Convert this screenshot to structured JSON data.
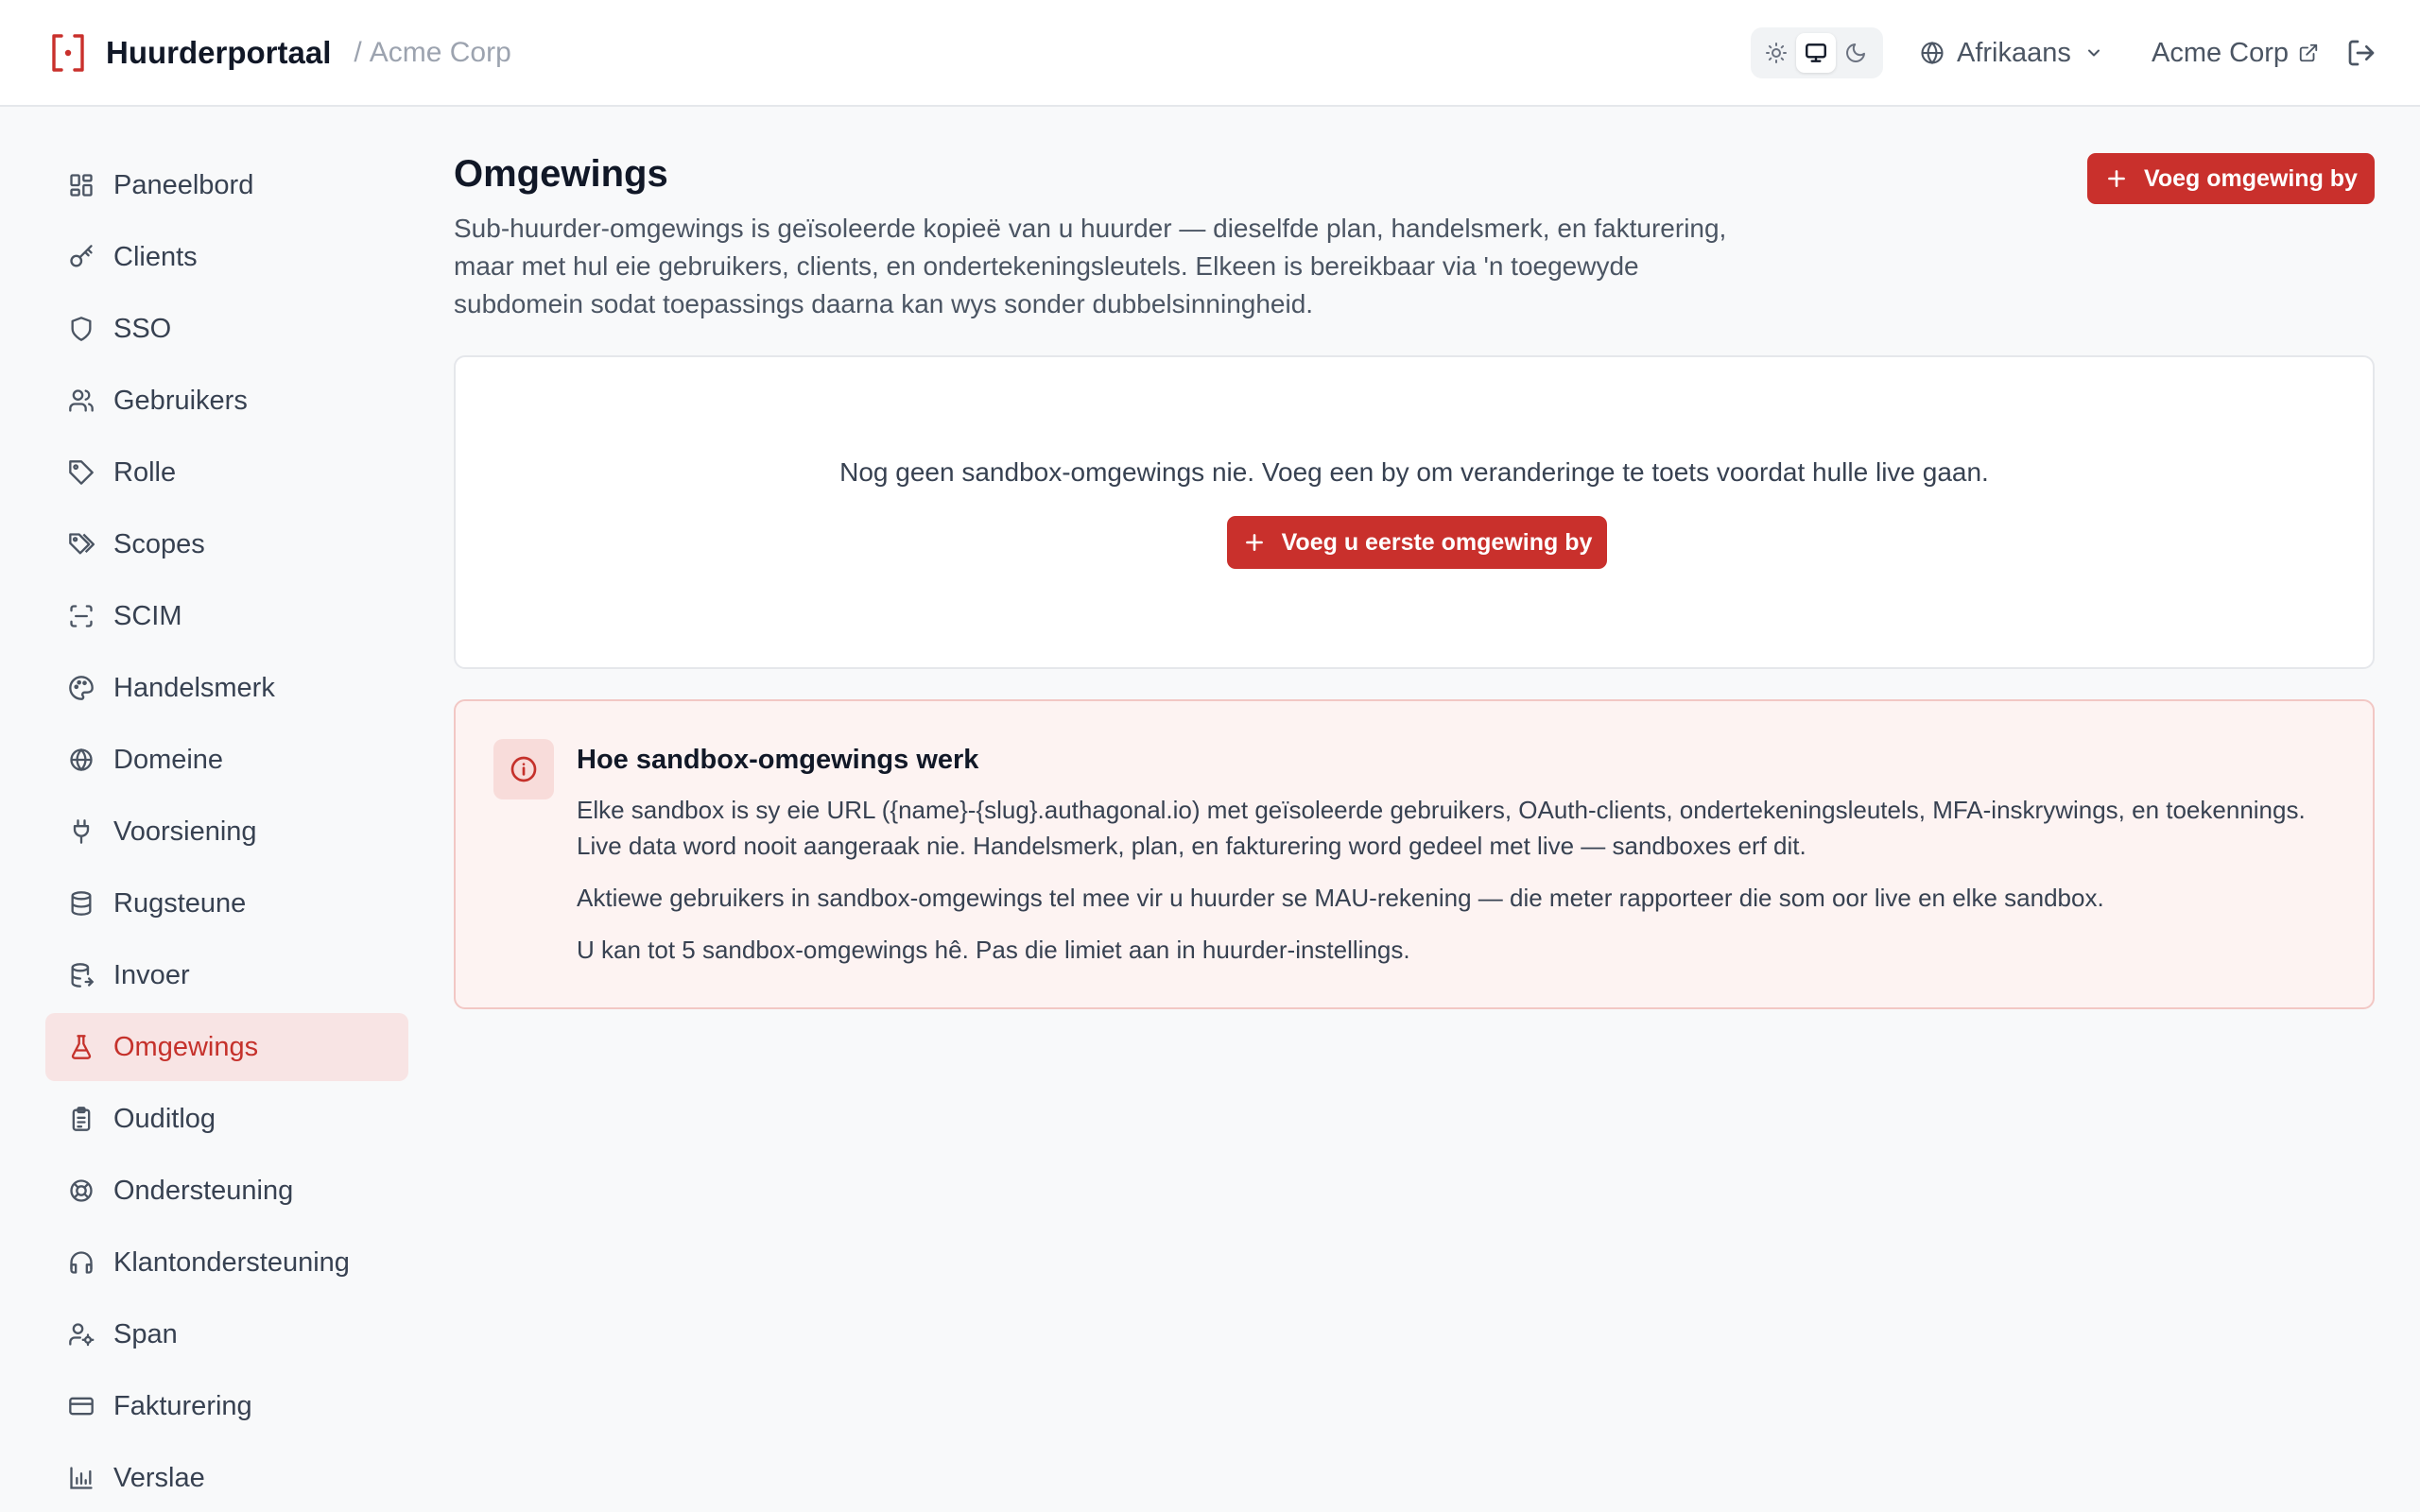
{
  "header": {
    "app_name": "Huurderportaal",
    "separator": "/",
    "org_name": "Acme Corp",
    "language": "Afrikaans",
    "org_link": "Acme Corp",
    "theme_active": "system",
    "brand_color": "#c9302c"
  },
  "sidebar": {
    "items": [
      {
        "label": "Paneelbord",
        "icon": "dashboard-icon"
      },
      {
        "label": "Clients",
        "icon": "key-icon"
      },
      {
        "label": "SSO",
        "icon": "shield-icon"
      },
      {
        "label": "Gebruikers",
        "icon": "users-icon"
      },
      {
        "label": "Rolle",
        "icon": "tag-icon"
      },
      {
        "label": "Scopes",
        "icon": "tags-icon"
      },
      {
        "label": "SCIM",
        "icon": "scan-icon"
      },
      {
        "label": "Handelsmerk",
        "icon": "palette-icon"
      },
      {
        "label": "Domeine",
        "icon": "globe-icon"
      },
      {
        "label": "Voorsiening",
        "icon": "plug-icon"
      },
      {
        "label": "Rugsteune",
        "icon": "database-icon"
      },
      {
        "label": "Invoer",
        "icon": "database-import-icon"
      },
      {
        "label": "Omgewings",
        "icon": "flask-icon",
        "active": true
      },
      {
        "label": "Ouditlog",
        "icon": "clipboard-icon"
      },
      {
        "label": "Ondersteuning",
        "icon": "lifebuoy-icon"
      },
      {
        "label": "Klantondersteuning",
        "icon": "headphones-icon"
      },
      {
        "label": "Span",
        "icon": "user-cog-icon"
      },
      {
        "label": "Fakturering",
        "icon": "credit-card-icon"
      },
      {
        "label": "Verslae",
        "icon": "bar-chart-icon"
      }
    ]
  },
  "main": {
    "title": "Omgewings",
    "description": "Sub-huurder-omgewings is geïsoleerde kopieë van u huurder — dieselfde plan, handelsmerk, en fakturering, maar met hul eie gebruikers, clients, en ondertekeningsleutels. Elkeen is bereikbaar via 'n toegewyde subdomein sodat toepassings daarna kan wys sonder dubbelsinningheid.",
    "add_button": "Voeg omgewing by",
    "empty": {
      "message": "Nog geen sandbox-omgewings nie. Voeg een by om veranderinge te toets voordat hulle live gaan.",
      "button": "Voeg u eerste omgewing by"
    },
    "info": {
      "title": "Hoe sandbox-omgewings werk",
      "paragraphs": [
        "Elke sandbox is sy eie URL ({name}-{slug}.authagonal.io) met geïsoleerde gebruikers, OAuth-clients, ondertekeningsleutels, MFA-inskrywings, en toekennings. Live data word nooit aangeraak nie. Handelsmerk, plan, en fakturering word gedeel met live — sandboxes erf dit.",
        "Aktiewe gebruikers in sandbox-omgewings tel mee vir u huurder se MAU-rekening — die meter rapporteer die som oor live en elke sandbox.",
        "U kan tot 5 sandbox-omgewings hê. Pas die limiet aan in huurder-instellings."
      ]
    }
  }
}
